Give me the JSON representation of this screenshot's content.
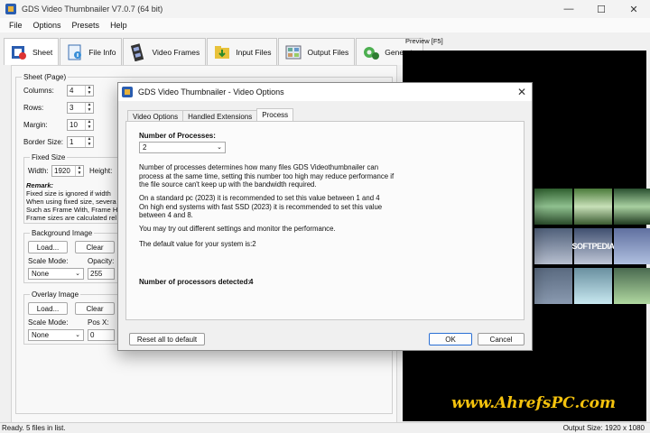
{
  "window": {
    "title": "GDS Video Thumbnailer V7.0.7 (64 bit)",
    "controls": [
      "—",
      "☐",
      "✕"
    ]
  },
  "menu": [
    "File",
    "Options",
    "Presets",
    "Help"
  ],
  "toolbar": {
    "tabs": [
      {
        "label": "Sheet",
        "icon": "sheet-icon"
      },
      {
        "label": "File Info",
        "icon": "file-info-icon"
      },
      {
        "label": "Video Frames",
        "icon": "film-icon"
      },
      {
        "label": "Input Files",
        "icon": "input-files-icon"
      },
      {
        "label": "Output Files",
        "icon": "output-files-icon"
      },
      {
        "label": "Generate",
        "icon": "generate-icon"
      }
    ],
    "active": "Sheet"
  },
  "sheet": {
    "group_title": "Sheet (Page)",
    "columns_label": "Columns:",
    "columns_value": "4",
    "rows_label": "Rows:",
    "rows_value": "3",
    "margin_label": "Margin:",
    "margin_value": "10",
    "border_label": "Border Size:",
    "border_value": "1",
    "fixed_size": {
      "title": "Fixed Size",
      "width_label": "Width:",
      "width_value": "1920",
      "height_label": "Height:",
      "remark_title": "Remark:",
      "remark_lines": [
        "Fixed size is ignored if width",
        "When using fixed size, severa",
        "Such as Frame With, Frame H",
        "Frame sizes are calculated rel"
      ]
    },
    "background": {
      "title": "Background Image",
      "load_label": "Load...",
      "clear_label": "Clear",
      "scale_label": "Scale Mode:",
      "scale_value": "None",
      "opacity_label": "Opacity:",
      "opacity_value": "255"
    },
    "overlay": {
      "title": "Overlay Image",
      "load_label": "Load...",
      "clear_label": "Clear",
      "scale_label": "Scale Mode:",
      "scale_value": "None",
      "posx_label": "Pos X:",
      "posx_value": "0"
    }
  },
  "preview": {
    "label": "Preview  [F5]",
    "thumb_watermark": "SOFTPEDIA"
  },
  "watermark": "www.AhrefsPC.com",
  "status": {
    "left": "Ready. 5 files in list.",
    "right": "Output Size: 1920 x 1080"
  },
  "dialog": {
    "title": "GDS Video Thumbnailer - Video Options",
    "tabs": [
      "Video Options",
      "Handled Extensions",
      "Process"
    ],
    "active_tab": "Process",
    "num_processes_label": "Number of Processes:",
    "num_processes_value": "2",
    "para1": [
      "Number of processes determines how many files GDS Videothumbnailer can",
      "process at the same time, setting this number too high may reduce performance if",
      "the file source can't keep up with the bandwidth required."
    ],
    "para2": [
      "On a standard pc (2023) it is recommended to set this value between 1 and 4",
      "On high end systems with fast SSD (2023) it is recommended to set this value",
      "between 4 and 8."
    ],
    "para3": "You may try out different settings and monitor the performance.",
    "para4": "The default value for your system is:2",
    "detected_label": "Number of processors detected:",
    "detected_value": "4",
    "reset_label": "Reset all to default",
    "ok_label": "OK",
    "cancel_label": "Cancel"
  }
}
